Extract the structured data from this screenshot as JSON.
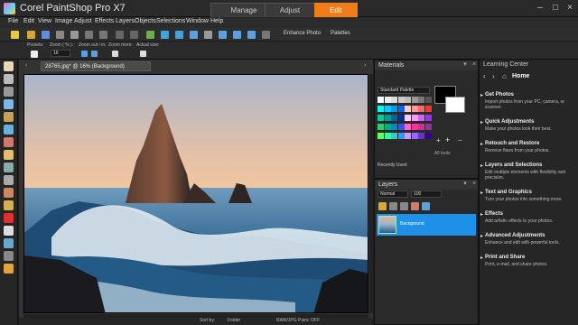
{
  "app": {
    "title": "Corel PaintShop Pro X7",
    "modes": [
      "Manage",
      "Adjust",
      "Edit"
    ],
    "active_mode": "Edit"
  },
  "menu": [
    "File",
    "Edit",
    "View",
    "Image",
    "Adjust",
    "Effects",
    "Layers",
    "Objects",
    "Selections",
    "Window",
    "Help"
  ],
  "toolbar": {
    "enhance_photo": "Enhance Photo",
    "palettes": "Palettes"
  },
  "options": {
    "presets": "Presets:",
    "zoom_pct": "Zoom ( % ):",
    "zoom_value": "16",
    "zoom_out_in": "Zoom out / in:",
    "zoom_more": "Zoom more:",
    "actual_size": "Actual size:"
  },
  "document": {
    "tab_label": "28765.jpg* @ 16% (Background)"
  },
  "materials": {
    "title": "Materials",
    "palette_select": "Standard Palette",
    "recently_used": "Recently Used",
    "all_tools": "All tools",
    "swatch_colors": [
      "#ffffff",
      "#eeeeee",
      "#dddddd",
      "#cccccc",
      "#bbbbbb",
      "#999999",
      "#777777",
      "#555555",
      "#00ffff",
      "#00ccff",
      "#0099ff",
      "#0066ff",
      "#ffcccc",
      "#ff9999",
      "#ff6666",
      "#ff3333",
      "#00cc99",
      "#009999",
      "#006699",
      "#003399",
      "#ffccff",
      "#ff99ff",
      "#cc66ff",
      "#9933ff",
      "#33cc66",
      "#00aa88",
      "#0088cc",
      "#3355ff",
      "#ff66cc",
      "#ff3399",
      "#cc3399",
      "#993399",
      "#66ff66",
      "#33ff99",
      "#33cccc",
      "#3399ff",
      "#cc99ff",
      "#9966ff",
      "#6633cc",
      "#330099"
    ]
  },
  "layers": {
    "title": "Layers",
    "blend_mode": "Normal",
    "opacity": "100",
    "items": [
      {
        "name": "Background"
      }
    ]
  },
  "learning_center": {
    "title": "Learning Center",
    "home": "Home",
    "sections": [
      {
        "title": "Get Photos",
        "desc": "Import photos from your PC, camera, or scanner."
      },
      {
        "title": "Quick Adjustments",
        "desc": "Make your photos look their best."
      },
      {
        "title": "Retouch and Restore",
        "desc": "Remove flaws from your photos."
      },
      {
        "title": "Layers and Selections",
        "desc": "Edit multiple elements with flexibility and precision."
      },
      {
        "title": "Text and Graphics",
        "desc": "Turn your photos into something more."
      },
      {
        "title": "Effects",
        "desc": "Add artistic effects to your photos."
      },
      {
        "title": "Advanced Adjustments",
        "desc": "Enhance and edit with powerful tools."
      },
      {
        "title": "Print and Share",
        "desc": "Print, e-mail, and share photos."
      }
    ]
  },
  "status": {
    "sort_by": "Sort by:",
    "sort_value": "Folder",
    "raw": "RAW/JPG Pairs: OFF"
  }
}
